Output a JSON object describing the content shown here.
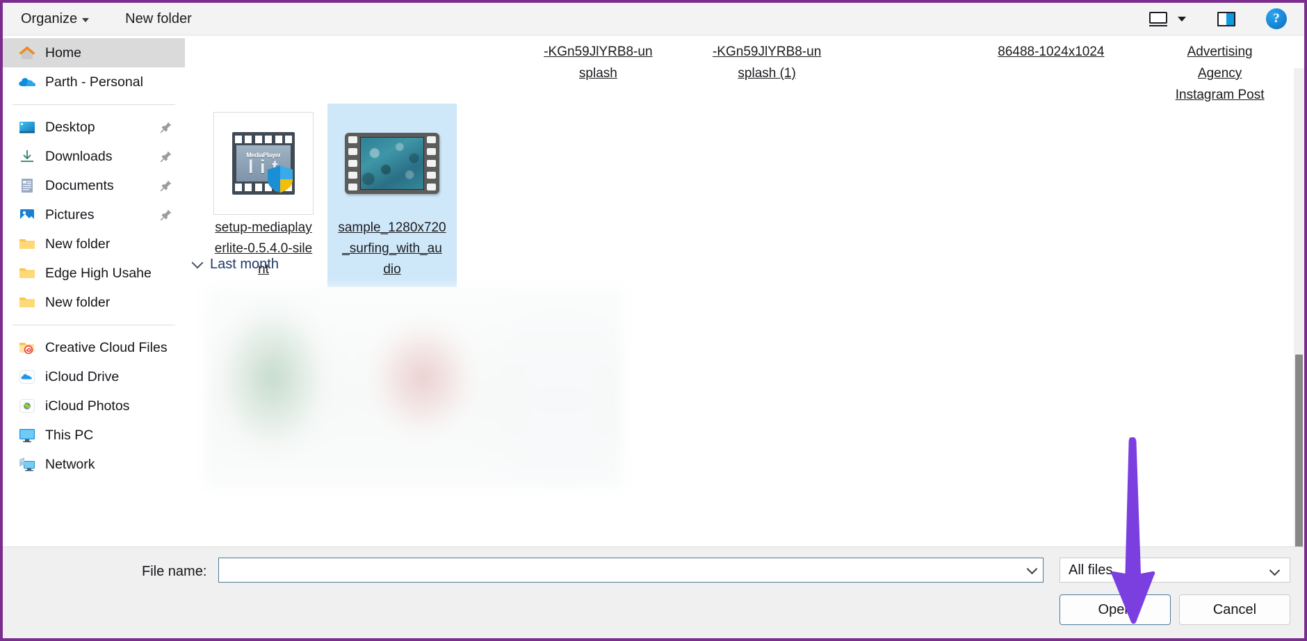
{
  "window": {
    "border_color": "#7B2D8E",
    "type": "file-open-dialog"
  },
  "toolbar": {
    "organize_label": "Organize",
    "new_folder_label": "New folder",
    "view_icon": "monitor-view-icon",
    "preview_pane_icon": "preview-pane-icon",
    "help_label": "?"
  },
  "sidebar": {
    "groups": [
      {
        "items": [
          {
            "label": "Home",
            "icon": "home-icon",
            "selected": true,
            "pinned": false
          },
          {
            "label": "Parth - Personal",
            "icon": "onedrive-cloud-icon",
            "selected": false,
            "pinned": false
          }
        ]
      },
      {
        "items": [
          {
            "label": "Desktop",
            "icon": "desktop-icon",
            "selected": false,
            "pinned": true
          },
          {
            "label": "Downloads",
            "icon": "downloads-icon",
            "selected": false,
            "pinned": true
          },
          {
            "label": "Documents",
            "icon": "documents-icon",
            "selected": false,
            "pinned": true
          },
          {
            "label": "Pictures",
            "icon": "pictures-icon",
            "selected": false,
            "pinned": true
          },
          {
            "label": "New folder",
            "icon": "folder-icon",
            "selected": false,
            "pinned": false
          },
          {
            "label": "Edge High Usahe",
            "icon": "folder-icon",
            "selected": false,
            "pinned": false
          },
          {
            "label": "New folder",
            "icon": "folder-icon",
            "selected": false,
            "pinned": false
          }
        ]
      },
      {
        "items": [
          {
            "label": "Creative Cloud Files",
            "icon": "creative-cloud-folder-icon",
            "selected": false,
            "pinned": false
          },
          {
            "label": "iCloud Drive",
            "icon": "icloud-drive-icon",
            "selected": false,
            "pinned": false
          },
          {
            "label": "iCloud Photos",
            "icon": "icloud-photos-icon",
            "selected": false,
            "pinned": false
          },
          {
            "label": "This PC",
            "icon": "this-pc-icon",
            "selected": false,
            "pinned": false
          },
          {
            "label": "Network",
            "icon": "network-icon",
            "selected": false,
            "pinned": false
          }
        ]
      }
    ]
  },
  "content": {
    "scrolled_names_top": [
      "-KGn59JlYRB8-un\nsplash",
      "-KGn59JlYRB8-un\nsplash (1)",
      "86488-1024x1024",
      "Advertising\nAgency\nInstagram Post"
    ],
    "files": [
      {
        "name": "setup-mediaplay\nerlite-0.5.4.0-sile\nnt",
        "thumbnail": "mediaplayerlite-installer-icon",
        "selected": false
      },
      {
        "name": "sample_1280x720\n_surfing_with_au\ndio",
        "thumbnail": "video-film-thumbnail",
        "selected": true
      }
    ],
    "group_header": {
      "label": "Last month",
      "expanded": true,
      "chevron_icon": "chevron-down-icon"
    },
    "blurred_region_present": true,
    "scrollbar": {
      "orientation": "vertical",
      "position": "lower"
    }
  },
  "bottom": {
    "filename_label": "File name:",
    "filename_value": "",
    "filename_placeholder": "",
    "filetype_value": "All files",
    "open_label": "Open",
    "cancel_label": "Cancel"
  },
  "annotation": {
    "arrow_color": "#7B3FE0",
    "arrow_icon": "down-arrow-annotation",
    "points_at": "Open"
  }
}
